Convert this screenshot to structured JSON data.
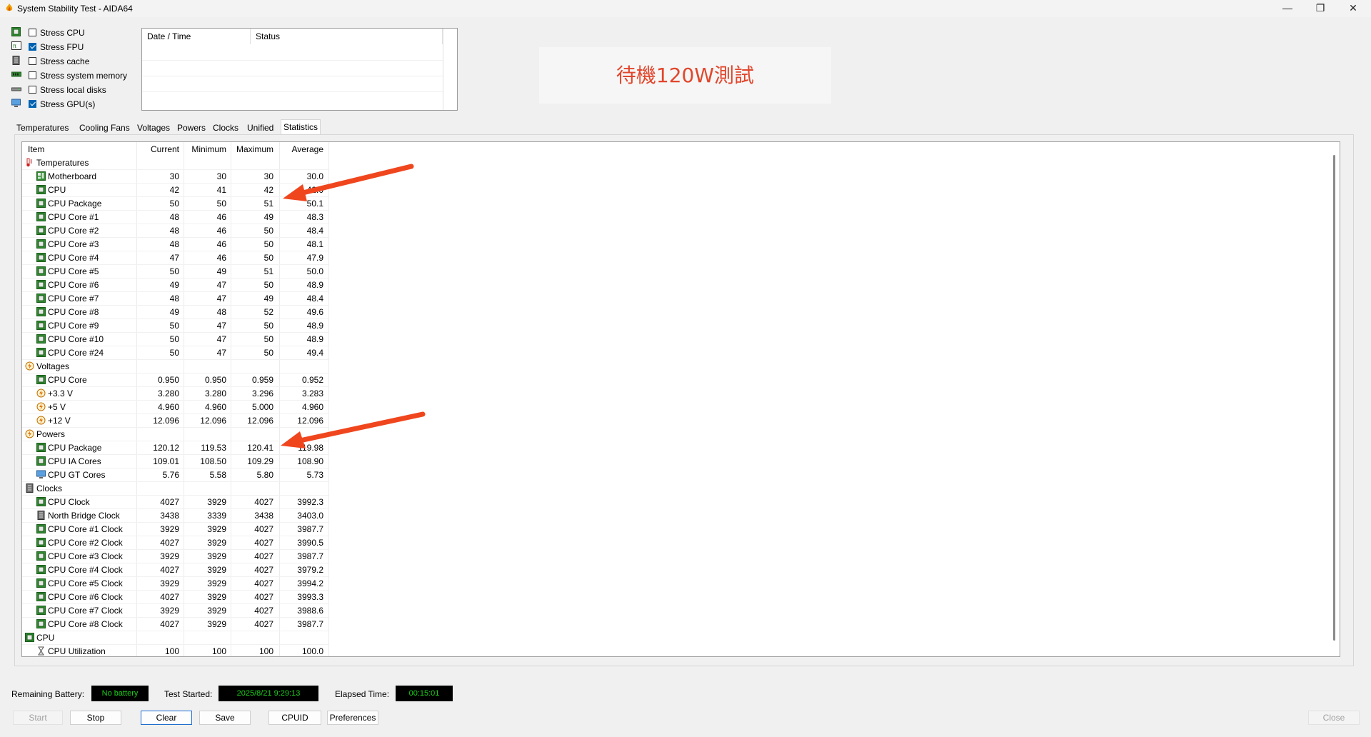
{
  "window": {
    "title": "System Stability Test - AIDA64",
    "minimize": "—",
    "maximize": "❐",
    "close": "✕"
  },
  "stress": [
    {
      "label": "Stress CPU",
      "checked": false,
      "icon": "cpu-chip-icon"
    },
    {
      "label": "Stress FPU",
      "checked": true,
      "icon": "fpu-chip-icon"
    },
    {
      "label": "Stress cache",
      "checked": false,
      "icon": "cache-icon"
    },
    {
      "label": "Stress system memory",
      "checked": false,
      "icon": "memory-icon"
    },
    {
      "label": "Stress local disks",
      "checked": false,
      "icon": "disk-icon"
    },
    {
      "label": "Stress GPU(s)",
      "checked": true,
      "icon": "monitor-icon"
    }
  ],
  "log": {
    "col_datetime": "Date / Time",
    "col_status": "Status"
  },
  "banner": "待機120W測試",
  "tabs": [
    "Temperatures",
    "Cooling Fans",
    "Voltages",
    "Powers",
    "Clocks",
    "Unified",
    "Statistics"
  ],
  "active_tab": "Statistics",
  "table": {
    "headers": {
      "item": "Item",
      "current": "Current",
      "minimum": "Minimum",
      "maximum": "Maximum",
      "average": "Average"
    },
    "rows": [
      {
        "type": "group",
        "name": "Temperatures",
        "icon": "thermometer-icon"
      },
      {
        "type": "item",
        "name": "Motherboard",
        "icon": "motherboard-icon",
        "cur": "30",
        "min": "30",
        "max": "30",
        "avg": "30.0"
      },
      {
        "type": "item",
        "name": "CPU",
        "icon": "chip-icon",
        "cur": "42",
        "min": "41",
        "max": "42",
        "avg": "42.0"
      },
      {
        "type": "item",
        "name": "CPU Package",
        "icon": "chip-icon",
        "cur": "50",
        "min": "50",
        "max": "51",
        "avg": "50.1"
      },
      {
        "type": "item",
        "name": "CPU Core #1",
        "icon": "chip-icon",
        "cur": "48",
        "min": "46",
        "max": "49",
        "avg": "48.3"
      },
      {
        "type": "item",
        "name": "CPU Core #2",
        "icon": "chip-icon",
        "cur": "48",
        "min": "46",
        "max": "50",
        "avg": "48.4"
      },
      {
        "type": "item",
        "name": "CPU Core #3",
        "icon": "chip-icon",
        "cur": "48",
        "min": "46",
        "max": "50",
        "avg": "48.1"
      },
      {
        "type": "item",
        "name": "CPU Core #4",
        "icon": "chip-icon",
        "cur": "47",
        "min": "46",
        "max": "50",
        "avg": "47.9"
      },
      {
        "type": "item",
        "name": "CPU Core #5",
        "icon": "chip-icon",
        "cur": "50",
        "min": "49",
        "max": "51",
        "avg": "50.0"
      },
      {
        "type": "item",
        "name": "CPU Core #6",
        "icon": "chip-icon",
        "cur": "49",
        "min": "47",
        "max": "50",
        "avg": "48.9"
      },
      {
        "type": "item",
        "name": "CPU Core #7",
        "icon": "chip-icon",
        "cur": "48",
        "min": "47",
        "max": "49",
        "avg": "48.4"
      },
      {
        "type": "item",
        "name": "CPU Core #8",
        "icon": "chip-icon",
        "cur": "49",
        "min": "48",
        "max": "52",
        "avg": "49.6"
      },
      {
        "type": "item",
        "name": "CPU Core #9",
        "icon": "chip-icon",
        "cur": "50",
        "min": "47",
        "max": "50",
        "avg": "48.9"
      },
      {
        "type": "item",
        "name": "CPU Core #10",
        "icon": "chip-icon",
        "cur": "50",
        "min": "47",
        "max": "50",
        "avg": "48.9"
      },
      {
        "type": "item",
        "name": "CPU Core #24",
        "icon": "chip-icon",
        "cur": "50",
        "min": "47",
        "max": "50",
        "avg": "49.4"
      },
      {
        "type": "group",
        "name": "Voltages",
        "icon": "voltage-icon"
      },
      {
        "type": "item",
        "name": "CPU Core",
        "icon": "chip-icon",
        "cur": "0.950",
        "min": "0.950",
        "max": "0.959",
        "avg": "0.952"
      },
      {
        "type": "item",
        "name": "+3.3 V",
        "icon": "voltage-icon",
        "cur": "3.280",
        "min": "3.280",
        "max": "3.296",
        "avg": "3.283"
      },
      {
        "type": "item",
        "name": "+5 V",
        "icon": "voltage-icon",
        "cur": "4.960",
        "min": "4.960",
        "max": "5.000",
        "avg": "4.960"
      },
      {
        "type": "item",
        "name": "+12 V",
        "icon": "voltage-icon",
        "cur": "12.096",
        "min": "12.096",
        "max": "12.096",
        "avg": "12.096"
      },
      {
        "type": "group",
        "name": "Powers",
        "icon": "voltage-icon"
      },
      {
        "type": "item",
        "name": "CPU Package",
        "icon": "chip-icon",
        "cur": "120.12",
        "min": "119.53",
        "max": "120.41",
        "avg": "119.98"
      },
      {
        "type": "item",
        "name": "CPU IA Cores",
        "icon": "chip-icon",
        "cur": "109.01",
        "min": "108.50",
        "max": "109.29",
        "avg": "108.90"
      },
      {
        "type": "item",
        "name": "CPU GT Cores",
        "icon": "monitor-icon",
        "cur": "5.76",
        "min": "5.58",
        "max": "5.80",
        "avg": "5.73"
      },
      {
        "type": "group",
        "name": "Clocks",
        "icon": "cache-icon"
      },
      {
        "type": "item",
        "name": "CPU Clock",
        "icon": "chip-icon",
        "cur": "4027",
        "min": "3929",
        "max": "4027",
        "avg": "3992.3"
      },
      {
        "type": "item",
        "name": "North Bridge Clock",
        "icon": "cache-icon",
        "cur": "3438",
        "min": "3339",
        "max": "3438",
        "avg": "3403.0"
      },
      {
        "type": "item",
        "name": "CPU Core #1 Clock",
        "icon": "chip-icon",
        "cur": "3929",
        "min": "3929",
        "max": "4027",
        "avg": "3987.7"
      },
      {
        "type": "item",
        "name": "CPU Core #2 Clock",
        "icon": "chip-icon",
        "cur": "4027",
        "min": "3929",
        "max": "4027",
        "avg": "3990.5"
      },
      {
        "type": "item",
        "name": "CPU Core #3 Clock",
        "icon": "chip-icon",
        "cur": "3929",
        "min": "3929",
        "max": "4027",
        "avg": "3987.7"
      },
      {
        "type": "item",
        "name": "CPU Core #4 Clock",
        "icon": "chip-icon",
        "cur": "4027",
        "min": "3929",
        "max": "4027",
        "avg": "3979.2"
      },
      {
        "type": "item",
        "name": "CPU Core #5 Clock",
        "icon": "chip-icon",
        "cur": "3929",
        "min": "3929",
        "max": "4027",
        "avg": "3994.2"
      },
      {
        "type": "item",
        "name": "CPU Core #6 Clock",
        "icon": "chip-icon",
        "cur": "4027",
        "min": "3929",
        "max": "4027",
        "avg": "3993.3"
      },
      {
        "type": "item",
        "name": "CPU Core #7 Clock",
        "icon": "chip-icon",
        "cur": "3929",
        "min": "3929",
        "max": "4027",
        "avg": "3988.6"
      },
      {
        "type": "item",
        "name": "CPU Core #8 Clock",
        "icon": "chip-icon",
        "cur": "4027",
        "min": "3929",
        "max": "4027",
        "avg": "3987.7"
      },
      {
        "type": "group",
        "name": "CPU",
        "icon": "chip-icon"
      },
      {
        "type": "item",
        "name": "CPU Utilization",
        "icon": "hourglass-icon",
        "cur": "100",
        "min": "100",
        "max": "100",
        "avg": "100.0"
      }
    ]
  },
  "status": {
    "battery_label": "Remaining Battery:",
    "battery_value": "No battery",
    "started_label": "Test Started:",
    "started_value": "2025/8/21 9:29:13",
    "elapsed_label": "Elapsed Time:",
    "elapsed_value": "00:15:01"
  },
  "buttons": {
    "start": "Start",
    "stop": "Stop",
    "clear": "Clear",
    "save": "Save",
    "cpuid": "CPUID",
    "preferences": "Preferences",
    "close": "Close"
  },
  "colors": {
    "accent": "#0063b1",
    "annotation_arrow": "#f0461e",
    "status_text": "#17d017",
    "banner_text": "#e2462c"
  }
}
